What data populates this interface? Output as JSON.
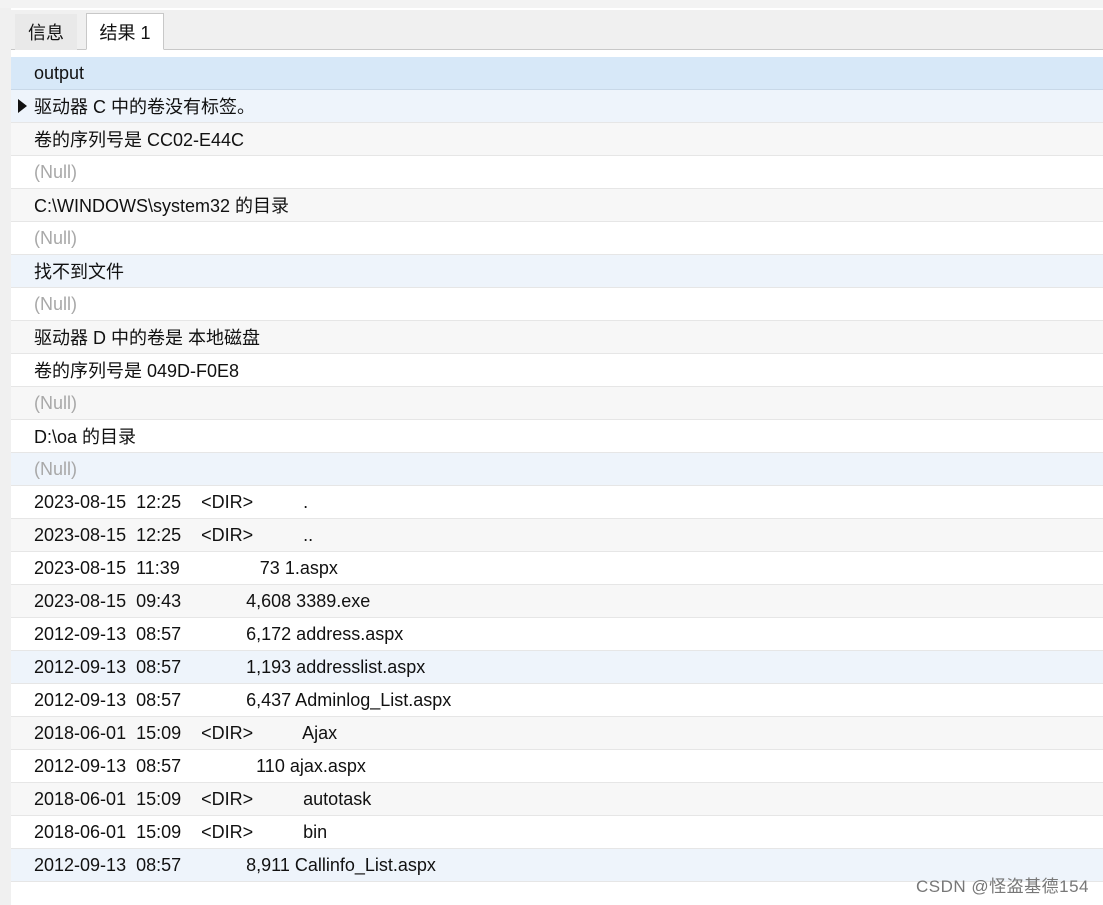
{
  "tabs": [
    {
      "label": "信息",
      "active": false
    },
    {
      "label": "结果 1",
      "active": true
    }
  ],
  "grid": {
    "column": "output",
    "rows": [
      {
        "value": "驱动器 C 中的卷没有标签。",
        "current": true,
        "null": false,
        "highlight": true
      },
      {
        "value": "卷的序列号是 CC02-E44C",
        "null": false
      },
      {
        "value": "(Null)",
        "null": true
      },
      {
        "value": "C:\\WINDOWS\\system32 的目录",
        "null": false
      },
      {
        "value": "(Null)",
        "null": true
      },
      {
        "value": "找不到文件",
        "null": false,
        "highlight": true
      },
      {
        "value": "(Null)",
        "null": true
      },
      {
        "value": "驱动器 D 中的卷是 本地磁盘",
        "null": false
      },
      {
        "value": "卷的序列号是 049D-F0E8",
        "null": false
      },
      {
        "value": "(Null)",
        "null": true
      },
      {
        "value": "D:\\oa 的目录",
        "null": false
      },
      {
        "value": "(Null)",
        "null": true,
        "highlight": true
      },
      {
        "value": "2023-08-15  12:25    <DIR>          .",
        "null": false
      },
      {
        "value": "2023-08-15  12:25    <DIR>          ..",
        "null": false
      },
      {
        "value": "2023-08-15  11:39                73 1.aspx",
        "null": false
      },
      {
        "value": "2023-08-15  09:43             4,608 3389.exe",
        "null": false
      },
      {
        "value": "2012-09-13  08:57             6,172 address.aspx",
        "null": false
      },
      {
        "value": "2012-09-13  08:57             1,193 addresslist.aspx",
        "null": false,
        "highlight": true
      },
      {
        "value": "2012-09-13  08:57             6,437 Adminlog_List.aspx",
        "null": false
      },
      {
        "value": "2018-06-01  15:09    <DIR>          Ajax",
        "null": false
      },
      {
        "value": "2012-09-13  08:57               110 ajax.aspx",
        "null": false
      },
      {
        "value": "2018-06-01  15:09    <DIR>          autotask",
        "null": false
      },
      {
        "value": "2018-06-01  15:09    <DIR>          bin",
        "null": false
      },
      {
        "value": "2012-09-13  08:57             8,911 Callinfo_List.aspx",
        "null": false,
        "highlight": true
      }
    ]
  },
  "watermark": "CSDN @怪盗基德154",
  "colors": {
    "header_bg": "#d7e8f8",
    "highlight_bg": "#eef4fb",
    "null_text": "#a8a8a8"
  }
}
